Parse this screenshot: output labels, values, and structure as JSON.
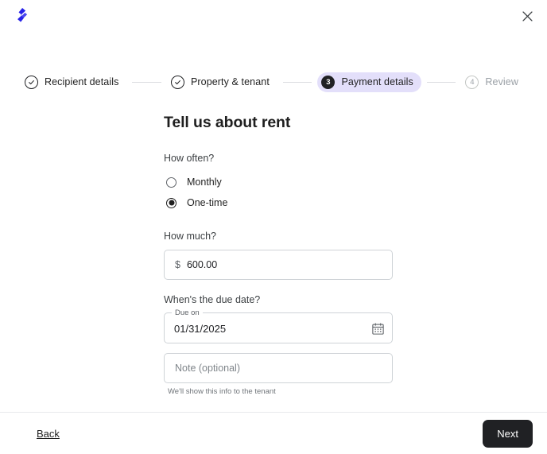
{
  "header": {
    "logo_icon": "brand-logo-icon",
    "close_icon": "close-icon",
    "close_label": "✕"
  },
  "stepper": {
    "steps": [
      {
        "label": "Recipient details",
        "marker": "✓",
        "state": "complete"
      },
      {
        "label": "Property & tenant",
        "marker": "✓",
        "state": "complete"
      },
      {
        "label": "Payment details",
        "marker": "3",
        "state": "active"
      },
      {
        "label": "Review",
        "marker": "4",
        "state": "upcoming"
      }
    ],
    "active_pill_color": "#e3dffa",
    "active_marker_color": "#202124"
  },
  "main": {
    "title": "Tell us about rent",
    "frequency": {
      "label": "How often?",
      "options": [
        {
          "label": "Monthly",
          "selected": false
        },
        {
          "label": "One-time",
          "selected": true
        }
      ]
    },
    "amount": {
      "label": "How much?",
      "currency_symbol": "$",
      "value": "600.00"
    },
    "due_date": {
      "question": "When's the due date?",
      "float_label": "Due on",
      "value": "01/31/2025",
      "calendar_icon": "calendar-icon"
    },
    "note": {
      "placeholder": "Note (optional)",
      "value": "",
      "helper_text": "We'll show this info to the tenant"
    }
  },
  "footer": {
    "back_label": "Back",
    "next_label": "Next",
    "next_bg": "#202124"
  }
}
